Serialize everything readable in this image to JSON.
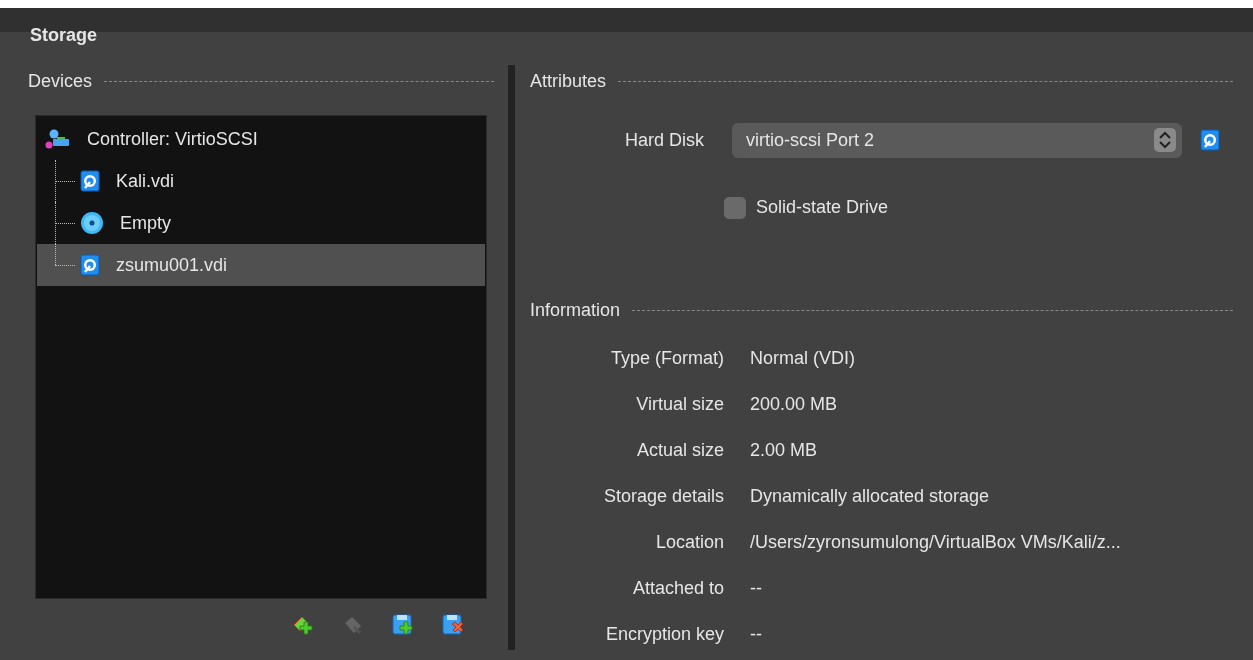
{
  "section_title": "Storage",
  "devices": {
    "title": "Devices",
    "tree": [
      {
        "label": "Controller: VirtioSCSI",
        "kind": "controller",
        "selected": false,
        "children": [
          {
            "label": "Kali.vdi",
            "kind": "hdd",
            "selected": false
          },
          {
            "label": "Empty",
            "kind": "optical",
            "selected": false
          },
          {
            "label": "zsumu001.vdi",
            "kind": "hdd",
            "selected": true
          }
        ]
      }
    ],
    "toolbar": [
      {
        "kind": "add-controller",
        "disabled": false
      },
      {
        "kind": "remove-controller",
        "disabled": true
      },
      {
        "kind": "add-attachment",
        "disabled": false
      },
      {
        "kind": "remove-attachment",
        "disabled": false
      }
    ]
  },
  "attributes": {
    "title": "Attributes",
    "hard_disk_label": "Hard Disk",
    "hard_disk_value": "virtio-scsi Port 2",
    "solid_state": {
      "label": "Solid-state Drive",
      "checked": false
    }
  },
  "information": {
    "title": "Information",
    "rows": [
      {
        "label": "Type (Format)",
        "value": "Normal (VDI)"
      },
      {
        "label": "Virtual size",
        "value": "200.00 MB"
      },
      {
        "label": "Actual size",
        "value": "2.00 MB"
      },
      {
        "label": "Storage details",
        "value": "Dynamically allocated storage"
      },
      {
        "label": "Location",
        "value": "/Users/zyronsumulong/VirtualBox VMs/Kali/z..."
      },
      {
        "label": "Attached to",
        "value": "--"
      },
      {
        "label": "Encryption key",
        "value": "--"
      }
    ]
  }
}
